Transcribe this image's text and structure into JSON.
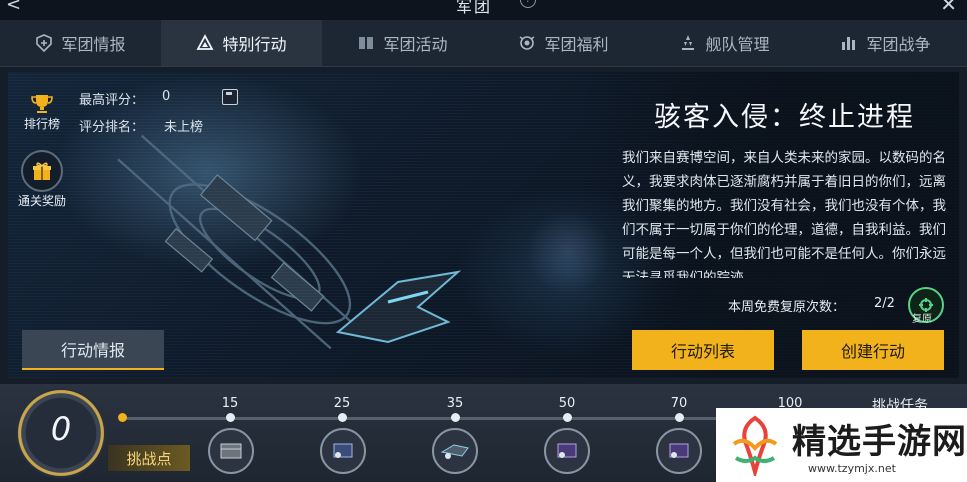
{
  "window": {
    "title": "军团",
    "back_glyph": "<",
    "close_glyph": "✕",
    "help_glyph": "?"
  },
  "tabs": [
    {
      "label": "军团情报",
      "icon": "shield-plus-icon"
    },
    {
      "label": "特别行动",
      "icon": "triangle-icon",
      "active": true
    },
    {
      "label": "军团活动",
      "icon": "book-icon"
    },
    {
      "label": "军团福利",
      "icon": "gift-ring-icon"
    },
    {
      "label": "舰队管理",
      "icon": "fleet-icon"
    },
    {
      "label": "军团战争",
      "icon": "bars-icon"
    }
  ],
  "stats": {
    "best_score_label": "最高评分：",
    "best_score_value": "0",
    "rank_label": "评分排名：",
    "rank_value": "未上榜"
  },
  "side_buttons": {
    "leaderboard": "排行榜",
    "rewards": "通关奖励"
  },
  "operation": {
    "title": "骇客入侵：终止进程",
    "description": "我们来自赛博空间，来自人类未来的家园。以数码的名义，我要求肉体已逐渐腐朽并属于着旧日的你们，远离我们聚集的地方。我们没有社会，我们也没有个体，我们不属于一切属于你们的伦理，道德，自我利益。我们可能是每一个人，但我们也可能不是任何人。你们永远无法寻觅我们的踪迹。",
    "revive_label": "本周免费复原次数：",
    "revive_count": "2/2",
    "revive_badge": "复原"
  },
  "buttons": {
    "intel": "行动情报",
    "op_list": "行动列表",
    "create_op": "创建行动"
  },
  "progress": {
    "current_points": "0",
    "points_label": "挑战点",
    "fill_fraction": 0.0,
    "milestones": [
      "15",
      "25",
      "35",
      "50",
      "70",
      "100"
    ],
    "challenge_label": "挑战任务"
  },
  "watermark": {
    "title": "精选手游网",
    "url": "www.tzymjx.net"
  },
  "colors": {
    "accent": "#f2b21c",
    "revive": "#5ad18a"
  }
}
